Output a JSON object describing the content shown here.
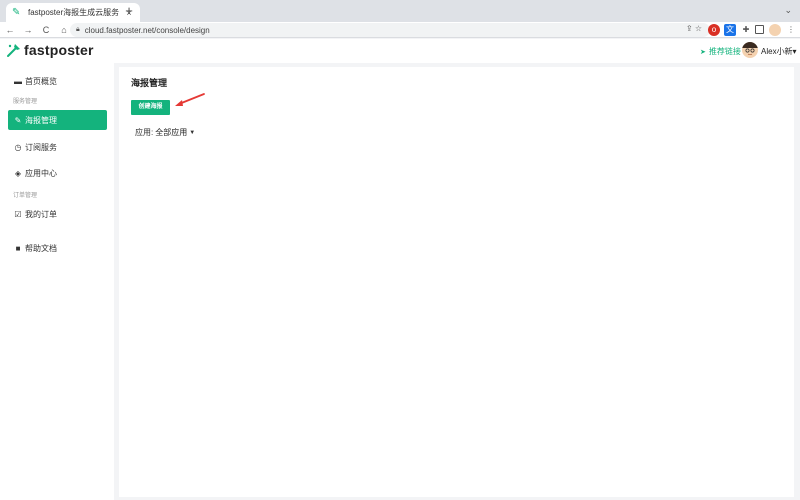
{
  "browser": {
    "tab_title": "fastposter海报生成云服务",
    "tab_close": "×",
    "new_tab": "+",
    "url": "cloud.fastposter.net/console/design",
    "nav_back": "←",
    "nav_forward": "→",
    "nav_reload": "C",
    "nav_home": "⌂",
    "omni_actions": "⇪ ☆"
  },
  "header": {
    "logo_text": "fastposter",
    "recommend_label": "推荐链接",
    "username": "Alex小新▾"
  },
  "sidebar": {
    "items": [
      {
        "label": "首页概览",
        "icon": "monitor-icon"
      },
      {
        "label": "海报管理",
        "icon": "edit-icon"
      },
      {
        "label": "订阅服务",
        "icon": "clock-icon"
      },
      {
        "label": "应用中心",
        "icon": "layers-icon"
      },
      {
        "label": "我的订单",
        "icon": "check-square-icon"
      },
      {
        "label": "帮助文档",
        "icon": "book-icon"
      }
    ],
    "groups": [
      "服务管理",
      "订单管理"
    ]
  },
  "main": {
    "title": "海报管理",
    "create_button": "创建海报",
    "filter_label": "应用:",
    "filter_value": "全部应用"
  },
  "colors": {
    "accent": "#14b37d",
    "annotation_arrow": "#e53935"
  }
}
